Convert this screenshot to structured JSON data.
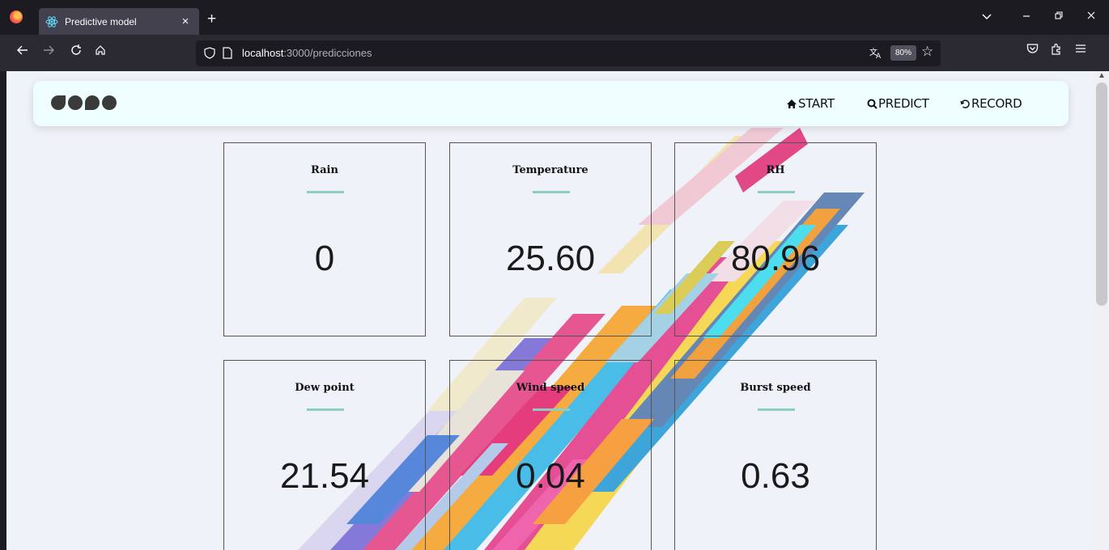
{
  "browser": {
    "tab_title": "Predictive model",
    "tab_close": "×",
    "new_tab": "+",
    "url_host": "localhost",
    "url_path": ":3000/predicciones",
    "zoom": "80%",
    "icons": [
      "firefox-logo-icon",
      "react-icon",
      "back-icon",
      "forward-icon",
      "reload-icon",
      "home-icon",
      "shield-icon",
      "page-icon",
      "translate-icon",
      "star-icon",
      "pocket-icon",
      "extensions-icon",
      "menu-icon",
      "chevron-down-icon",
      "minimize-icon",
      "restore-icon",
      "close-icon"
    ]
  },
  "site": {
    "nav": {
      "start": "START",
      "predict": "PREDICT",
      "record": "RECORD"
    }
  },
  "cards": [
    {
      "title": "Rain",
      "value": "0"
    },
    {
      "title": "Temperature",
      "value": "25.60"
    },
    {
      "title": "RH",
      "value": "80.96"
    },
    {
      "title": "Dew point",
      "value": "21.54"
    },
    {
      "title": "Wind speed",
      "value": "0.04"
    },
    {
      "title": "Burst speed",
      "value": "0.63"
    }
  ],
  "colors": {
    "accent_line": "#8fcdc4",
    "header_bg": "#eefdfd",
    "page_bg": "#eff2f8"
  }
}
